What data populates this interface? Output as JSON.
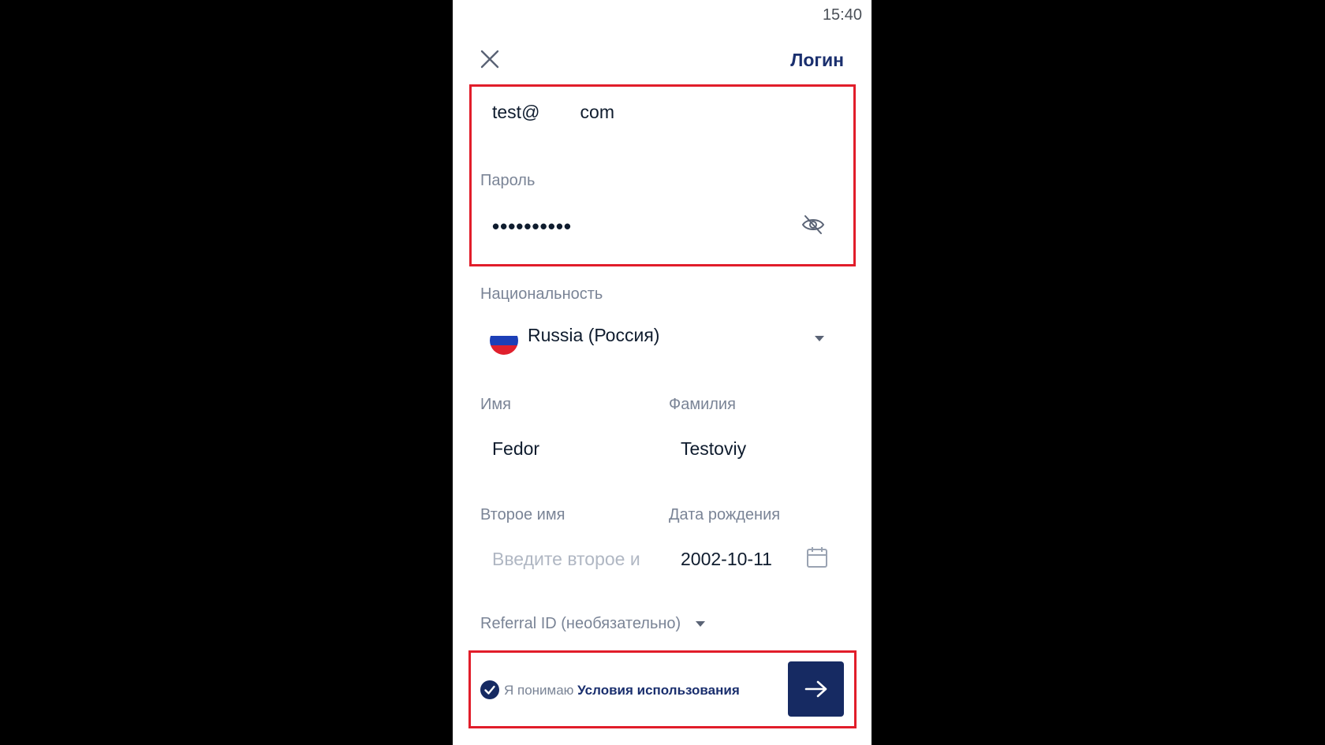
{
  "status_bar": {
    "time": "15:40"
  },
  "header": {
    "login_label": "Логин"
  },
  "email": {
    "value": "test@        com"
  },
  "password": {
    "label": "Пароль",
    "masked_value": "••••••••••"
  },
  "nationality": {
    "label": "Национальность",
    "value": "Russia (Россия)"
  },
  "first_name": {
    "label": "Имя",
    "value": "Fedor"
  },
  "last_name": {
    "label": "Фамилия",
    "value": "Testoviy"
  },
  "middle_name": {
    "label": "Второе имя",
    "placeholder": "Введите второе и"
  },
  "birth_date": {
    "label": "Дата рождения",
    "value": "2002-10-11"
  },
  "referral": {
    "label": "Referral ID (необязательно)"
  },
  "terms": {
    "prefix": "Я понимаю",
    "link": "Условия использования",
    "checked": true
  },
  "colors": {
    "accent": "#162a62",
    "highlight": "#e11d2a",
    "label": "#7a8496"
  },
  "icons": {
    "close": "close-icon",
    "password_toggle": "eye-off-icon",
    "dropdown": "chevron-down-icon",
    "calendar": "calendar-icon",
    "check": "check-circle-icon",
    "next": "arrow-right-icon"
  }
}
